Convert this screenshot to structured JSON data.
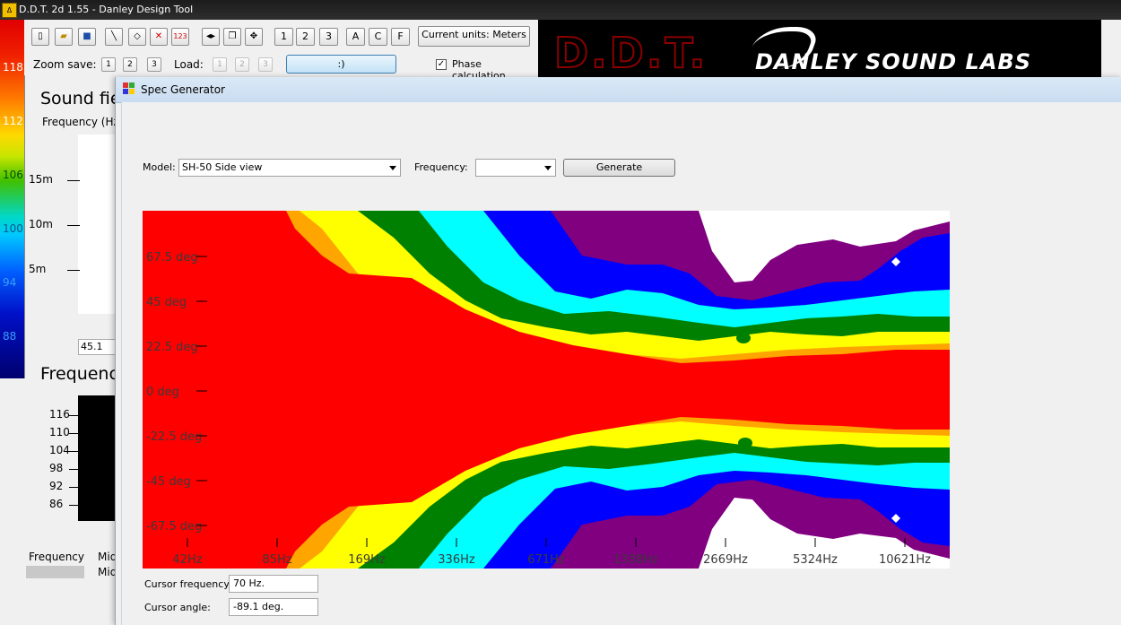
{
  "app": {
    "title": "D.D.T. 2d 1.55 - Danley Design Tool",
    "icon": "ddt-app-icon"
  },
  "colorbar": {
    "labels": [
      "118",
      "112",
      "106",
      "100",
      "94",
      "88"
    ]
  },
  "toolbar": {
    "icon_buttons": [
      "new-file-icon",
      "open-folder-icon",
      "save-disk-icon",
      "line-tool-icon",
      "eraser-icon",
      "delete-x-icon",
      "numbering-icon",
      "flip-icon",
      "copy-icon",
      "move-icon"
    ],
    "number_buttons": [
      "1",
      "2",
      "3"
    ],
    "letter_buttons": [
      "A",
      "C",
      "F"
    ],
    "units_label": "Current units: Meters",
    "zoom_save_label": "Zoom save:",
    "zoom_save_buttons": [
      "1",
      "2",
      "3"
    ],
    "load_label": "Load:",
    "load_buttons": [
      "1",
      "2",
      "3"
    ],
    "smile_label": ":)",
    "phase_label": "Phase calculation",
    "phase_checked": true
  },
  "logo": {
    "ddt": "D.D.T.",
    "danley": "DANLEY SOUND LABS"
  },
  "background_window": {
    "sound_field_title": "Sound fie",
    "frequency_sub": "Frequency (Hz",
    "y_ticks": [
      "15m",
      "10m",
      "5m"
    ],
    "angle_value": "45.1",
    "frequency_title": "Frequenc",
    "level_ticks": [
      "116",
      "110",
      "104",
      "98",
      "92",
      "86"
    ],
    "bottom_frequency": "Frequency",
    "bottom_mid1": "Mid",
    "bottom_mid2": "Mid"
  },
  "dialog": {
    "title": "Spec Generator",
    "model_label": "Model:",
    "model_value": "SH-50 Side view",
    "frequency_label": "Frequency:",
    "frequency_value": "",
    "generate_label": "Generate",
    "cursor_frequency_label": "Cursor frequency:",
    "cursor_frequency_value": "70 Hz.",
    "cursor_angle_label": "Cursor angle:",
    "cursor_angle_value": "-89.1 deg."
  },
  "plot": {
    "y_labels": [
      "67.5 deg",
      "45 deg",
      "22.5 deg",
      "0 deg",
      "-22.5 deg",
      "-45 deg",
      "-67.5 deg"
    ],
    "x_labels": [
      "42Hz",
      "85Hz",
      "169Hz",
      "336Hz",
      "671Hz",
      "1338Hz",
      "2669Hz",
      "5324Hz",
      "10621Hz"
    ],
    "colors": {
      "red": "#ff0000",
      "orange": "#ffa500",
      "yellow": "#ffff00",
      "green": "#008000",
      "cyan": "#00ffff",
      "blue": "#0000ff",
      "purple": "#800080",
      "white": "#ffffff"
    }
  }
}
